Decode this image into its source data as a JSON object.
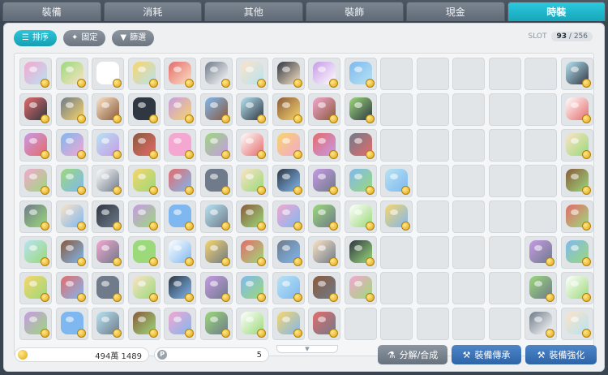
{
  "tabs": [
    "裝備",
    "消耗",
    "其他",
    "裝飾",
    "現金",
    "時裝"
  ],
  "active_tab": "時裝",
  "toolbar": {
    "sort_label": "排序",
    "pin_label": "固定",
    "filter_label": "篩選"
  },
  "slot": {
    "label": "SLOT",
    "used": "93",
    "separator": "/",
    "total": "256"
  },
  "grid": {
    "columns": 16,
    "rows": [
      [
        1,
        1,
        1,
        1,
        1,
        1,
        1,
        1,
        1,
        1,
        0,
        0,
        0,
        0,
        0,
        1
      ],
      [
        1,
        1,
        1,
        1,
        1,
        1,
        1,
        1,
        1,
        1,
        0,
        0,
        0,
        0,
        0,
        1
      ],
      [
        1,
        1,
        1,
        1,
        1,
        1,
        1,
        1,
        1,
        1,
        0,
        0,
        0,
        0,
        0,
        1
      ],
      [
        1,
        1,
        1,
        1,
        1,
        1,
        1,
        1,
        1,
        1,
        1,
        0,
        0,
        0,
        0,
        1
      ],
      [
        1,
        1,
        1,
        1,
        1,
        1,
        1,
        1,
        1,
        1,
        1,
        0,
        0,
        0,
        0,
        1
      ],
      [
        1,
        1,
        1,
        1,
        1,
        1,
        1,
        1,
        1,
        1,
        0,
        0,
        0,
        0,
        1,
        1
      ],
      [
        1,
        1,
        1,
        1,
        1,
        1,
        1,
        1,
        1,
        1,
        0,
        0,
        0,
        0,
        1,
        1
      ],
      [
        1,
        1,
        1,
        1,
        1,
        1,
        1,
        1,
        1,
        0,
        0,
        0,
        0,
        0,
        1,
        1
      ]
    ],
    "palette": [
      "#f4a7d0",
      "#6f7b8a",
      "#b7e3f2",
      "#f7d56a",
      "#c79ae6",
      "#9bd97a",
      "#fbe3c6",
      "#8a5a3c",
      "#e56b6b",
      "#7fb8f0",
      "#ffffff",
      "#2f3742"
    ]
  },
  "footer": {
    "meso_value": "494萬 1489",
    "points_icon_letter": "P",
    "points_value": "5",
    "btn_dismantle": "分解/合成",
    "btn_transfer": "裝備傳承",
    "btn_enhance": "裝備強化"
  },
  "colors": {
    "active_tab": "#1fb3c7",
    "toolbar_active": "#22b0c4",
    "blue_button": "#3a72b6"
  }
}
